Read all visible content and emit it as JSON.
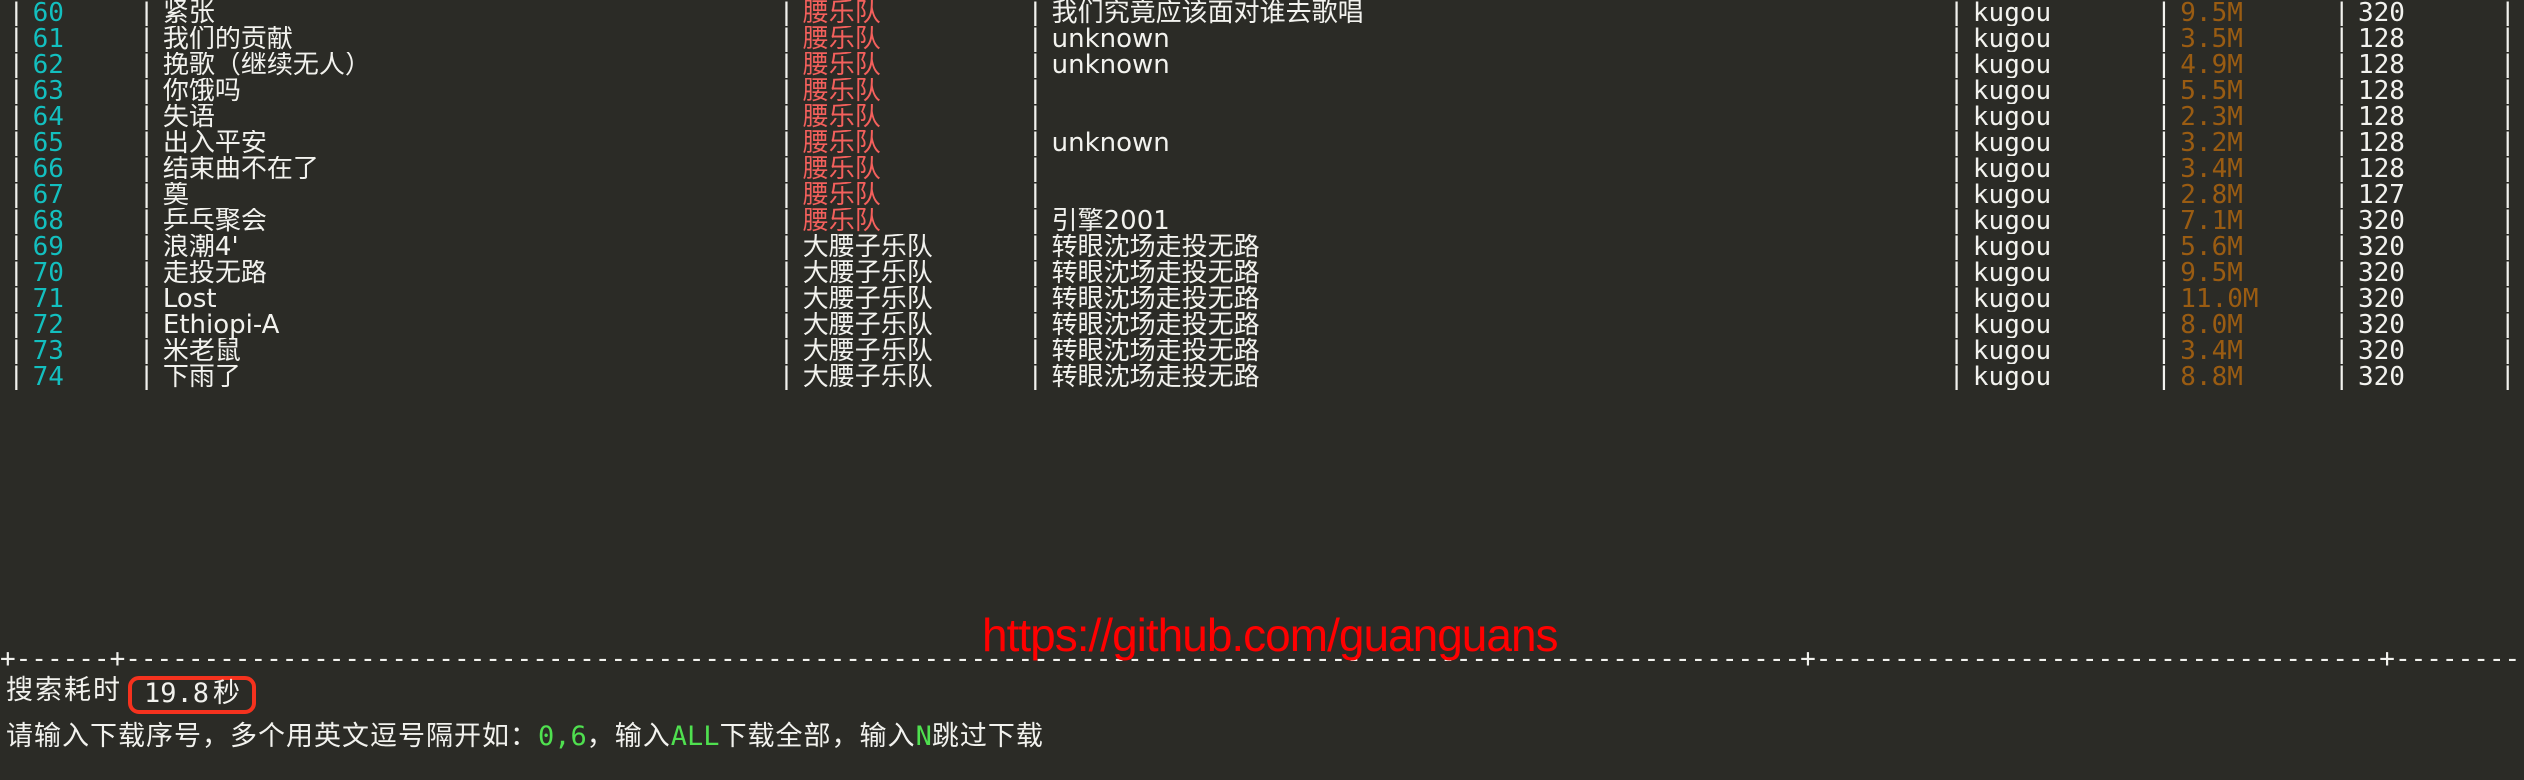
{
  "theme": {
    "background": "#2b2b26",
    "text": "#f2f2ee",
    "index_color": "#13bfbf",
    "artist_highlight": "#f4605c",
    "size_color": "#9a5c12",
    "green": "#4fe04f",
    "highlight_box_border": "#f5321e",
    "watermark_color": "#ff0000"
  },
  "table": {
    "rows": [
      {
        "index": "60",
        "song": "紧张",
        "artist": "腰乐队",
        "artist_style": "red",
        "album": "我们究竟应该面对谁去歌唱",
        "source": "kugou",
        "size": "9.5M",
        "bitrate": "320"
      },
      {
        "index": "61",
        "song": "我们的贡献",
        "artist": "腰乐队",
        "artist_style": "red",
        "album": "unknown",
        "source": "kugou",
        "size": "3.5M",
        "bitrate": "128"
      },
      {
        "index": "62",
        "song": "挽歌（继续无人）",
        "artist": "腰乐队",
        "artist_style": "red",
        "album": "unknown",
        "source": "kugou",
        "size": "4.9M",
        "bitrate": "128"
      },
      {
        "index": "63",
        "song": "你饿吗",
        "artist": "腰乐队",
        "artist_style": "red",
        "album": "",
        "source": "kugou",
        "size": "5.5M",
        "bitrate": "128"
      },
      {
        "index": "64",
        "song": "失语",
        "artist": "腰乐队",
        "artist_style": "red",
        "album": "",
        "source": "kugou",
        "size": "2.3M",
        "bitrate": "128"
      },
      {
        "index": "65",
        "song": "出入平安",
        "artist": "腰乐队",
        "artist_style": "red",
        "album": "unknown",
        "source": "kugou",
        "size": "3.2M",
        "bitrate": "128"
      },
      {
        "index": "66",
        "song": "结束曲不在了",
        "artist": "腰乐队",
        "artist_style": "red",
        "album": "",
        "source": "kugou",
        "size": "3.4M",
        "bitrate": "128"
      },
      {
        "index": "67",
        "song": "奠",
        "artist": "腰乐队",
        "artist_style": "red",
        "album": "",
        "source": "kugou",
        "size": "2.8M",
        "bitrate": "127"
      },
      {
        "index": "68",
        "song": "乒乓聚会",
        "artist": "腰乐队",
        "artist_style": "red",
        "album": "引擎2001",
        "source": "kugou",
        "size": "7.1M",
        "bitrate": "320"
      },
      {
        "index": "69",
        "song": "浪潮4'",
        "artist": "大腰子乐队",
        "artist_style": "white",
        "album": "转眼沈场走投无路",
        "source": "kugou",
        "size": "5.6M",
        "bitrate": "320"
      },
      {
        "index": "70",
        "song": "走投无路",
        "artist": "大腰子乐队",
        "artist_style": "white",
        "album": "转眼沈场走投无路",
        "source": "kugou",
        "size": "9.5M",
        "bitrate": "320"
      },
      {
        "index": "71",
        "song": "Lost",
        "artist": "大腰子乐队",
        "artist_style": "white",
        "album": "转眼沈场走投无路",
        "source": "kugou",
        "size": "11.0M",
        "bitrate": "320"
      },
      {
        "index": "72",
        "song": "Ethiopi-A",
        "artist": "大腰子乐队",
        "artist_style": "white",
        "album": "转眼沈场走投无路",
        "source": "kugou",
        "size": "8.0M",
        "bitrate": "320"
      },
      {
        "index": "73",
        "song": "米老鼠",
        "artist": "大腰子乐队",
        "artist_style": "white",
        "album": "转眼沈场走投无路",
        "source": "kugou",
        "size": "3.4M",
        "bitrate": "320"
      },
      {
        "index": "74",
        "song": "下雨了",
        "artist": "大腰子乐队",
        "artist_style": "white",
        "album": "转眼沈场走投无路",
        "source": "kugou",
        "size": "8.8M",
        "bitrate": "320"
      }
    ]
  },
  "bottom_rule": {
    "segments": [
      {
        "dashes": 6
      },
      {
        "dashes": 107
      },
      {
        "dashes": 36
      },
      {
        "dashes": 128
      },
      {
        "dashes": 27
      },
      {
        "dashes": 19
      },
      {
        "dashes": 20
      }
    ]
  },
  "status": {
    "label": "搜索耗时",
    "elapsed_value": "19.8",
    "elapsed_unit": "秒"
  },
  "prompt": {
    "part1": "请输入下载序号，多个用英文逗号隔开如：",
    "example": "0,6",
    "part2": "，输入",
    "all_keyword": "ALL",
    "part3": "下载全部，输入",
    "skip_keyword": "N",
    "part4": "跳过下载"
  },
  "watermark": {
    "url": "https://github.com/guanguans"
  }
}
